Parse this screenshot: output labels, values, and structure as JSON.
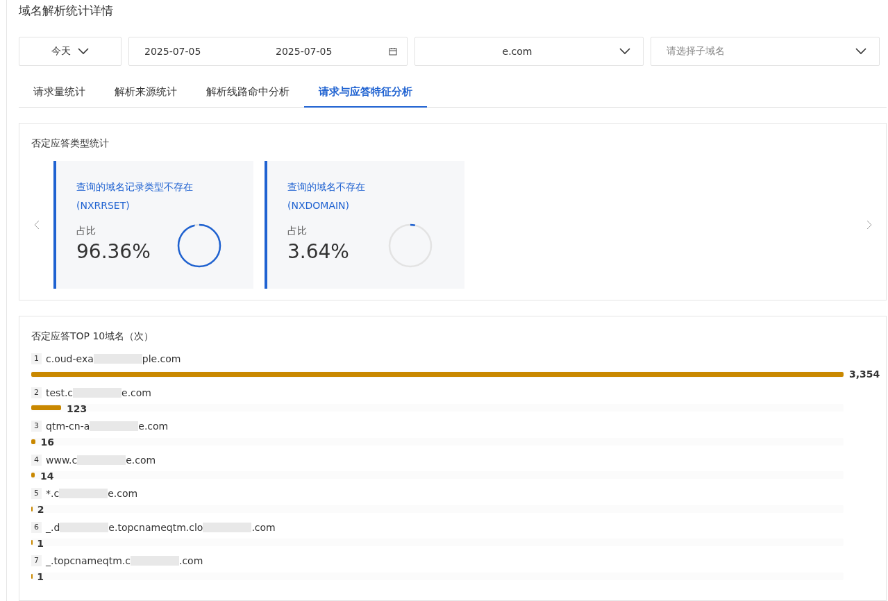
{
  "page_title": "域名解析统计详情",
  "filters": {
    "range": "今天",
    "start_date": "2025-07-05",
    "end_date": "2025-07-05",
    "domain": "e.com",
    "subdomain_placeholder": "请选择子域名"
  },
  "tabs": [
    {
      "label": "请求量统计",
      "selected": false
    },
    {
      "label": "解析来源统计",
      "selected": false
    },
    {
      "label": "解析线路命中分析",
      "selected": false
    },
    {
      "label": "请求与应答特征分析",
      "selected": true
    }
  ],
  "negative_types": {
    "title": "否定应答类型统计",
    "cards": [
      {
        "name": "查询的域名记录类型不存在",
        "code": "(NXRRSET)",
        "share_label": "占比",
        "share": "96.36%",
        "level": 0.9636
      },
      {
        "name": "查询的域名不存在",
        "code": "(NXDOMAIN)",
        "share_label": "占比",
        "share": "3.64%",
        "level": 0.0364
      }
    ]
  },
  "top_domains": {
    "title": "否定应答TOP 10域名（次）",
    "rows": [
      {
        "rank": "1",
        "domain_parts": [
          "c.oud-exa",
          "ple.com"
        ],
        "count": "3,354",
        "level": 1
      },
      {
        "rank": "2",
        "domain_parts": [
          "test.c",
          "e.com"
        ],
        "count": "123",
        "level": 0.0367
      },
      {
        "rank": "3",
        "domain_parts": [
          "qtm-cn-a",
          "e.com"
        ],
        "count": "16",
        "level": 0.0048
      },
      {
        "rank": "4",
        "domain_parts": [
          "www.c",
          "e.com"
        ],
        "count": "14",
        "level": 0.0042
      },
      {
        "rank": "5",
        "domain_parts": [
          "*.c",
          "e.com"
        ],
        "count": "2",
        "level": 0.0006
      },
      {
        "rank": "6",
        "domain_parts": [
          "_.d",
          "e.topcnameqtm.clo",
          ".com"
        ],
        "count": "1",
        "level": 0.0003
      },
      {
        "rank": "7",
        "domain_parts": [
          "_.topcnameqtm.c",
          ".com"
        ],
        "count": "1",
        "level": 0.0003
      }
    ]
  }
}
